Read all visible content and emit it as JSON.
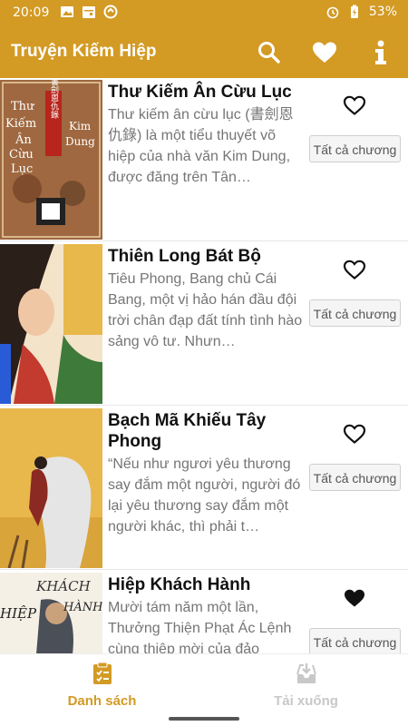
{
  "status_bar": {
    "time": "20:09",
    "battery": "53%",
    "icons_left": [
      "image-icon",
      "calendar-icon",
      "sync-icon"
    ],
    "icons_right": [
      "alarm-icon",
      "battery-charging-icon"
    ]
  },
  "app_bar": {
    "title": "Truyện Kiếm Hiệp",
    "actions": [
      "search-icon",
      "heart-icon",
      "info-icon"
    ]
  },
  "colors": {
    "primary": "#d39a24",
    "inactive": "#c8c8c8"
  },
  "books": [
    {
      "title": "Thư Kiếm Ân Cừu Lục",
      "description": "Thư kiếm ân cừu lục (書劍恩仇錄) là một tiểu thuyết võ hiệp của nhà văn Kim Dung, được đăng trên Tân…",
      "favorite": false,
      "chapters_label": "Tất cả chương",
      "cover_text": [
        "Thư",
        "Kiếm",
        "Ân",
        "Cừu",
        "Lục",
        "Kim",
        "Dung",
        "書劍恩仇錄"
      ]
    },
    {
      "title": "Thiên Long Bát Bộ",
      "description": "Tiêu Phong, Bang chủ Cái Bang, một vị hảo hán đầu đội trời chân đạp đất tính tình hào sảng vô tư. Nhưn…",
      "favorite": false,
      "chapters_label": "Tất cả chương"
    },
    {
      "title": "Bạch Mã Khiếu Tây Phong",
      "description": "“Nếu như ngươi yêu thương say đắm một người, người đó lại yêu thương say đắm một người khác, thì phải t…",
      "favorite": false,
      "chapters_label": "Tất cả chương"
    },
    {
      "title": "Hiệp Khách Hành",
      "description": "Mười tám năm một lần, Thưởng Thiện Phạt Ác Lệnh cùng thiệp mời của đảo",
      "favorite": true,
      "chapters_label": "Tất cả chương",
      "cover_text": [
        "KHÁCH",
        "HIỆP",
        "HÀNH"
      ]
    }
  ],
  "bottom_nav": {
    "tabs": [
      {
        "label": "Danh sách",
        "icon": "clipboard-list-icon",
        "active": true
      },
      {
        "label": "Tải xuống",
        "icon": "download-tray-icon",
        "active": false
      }
    ]
  }
}
